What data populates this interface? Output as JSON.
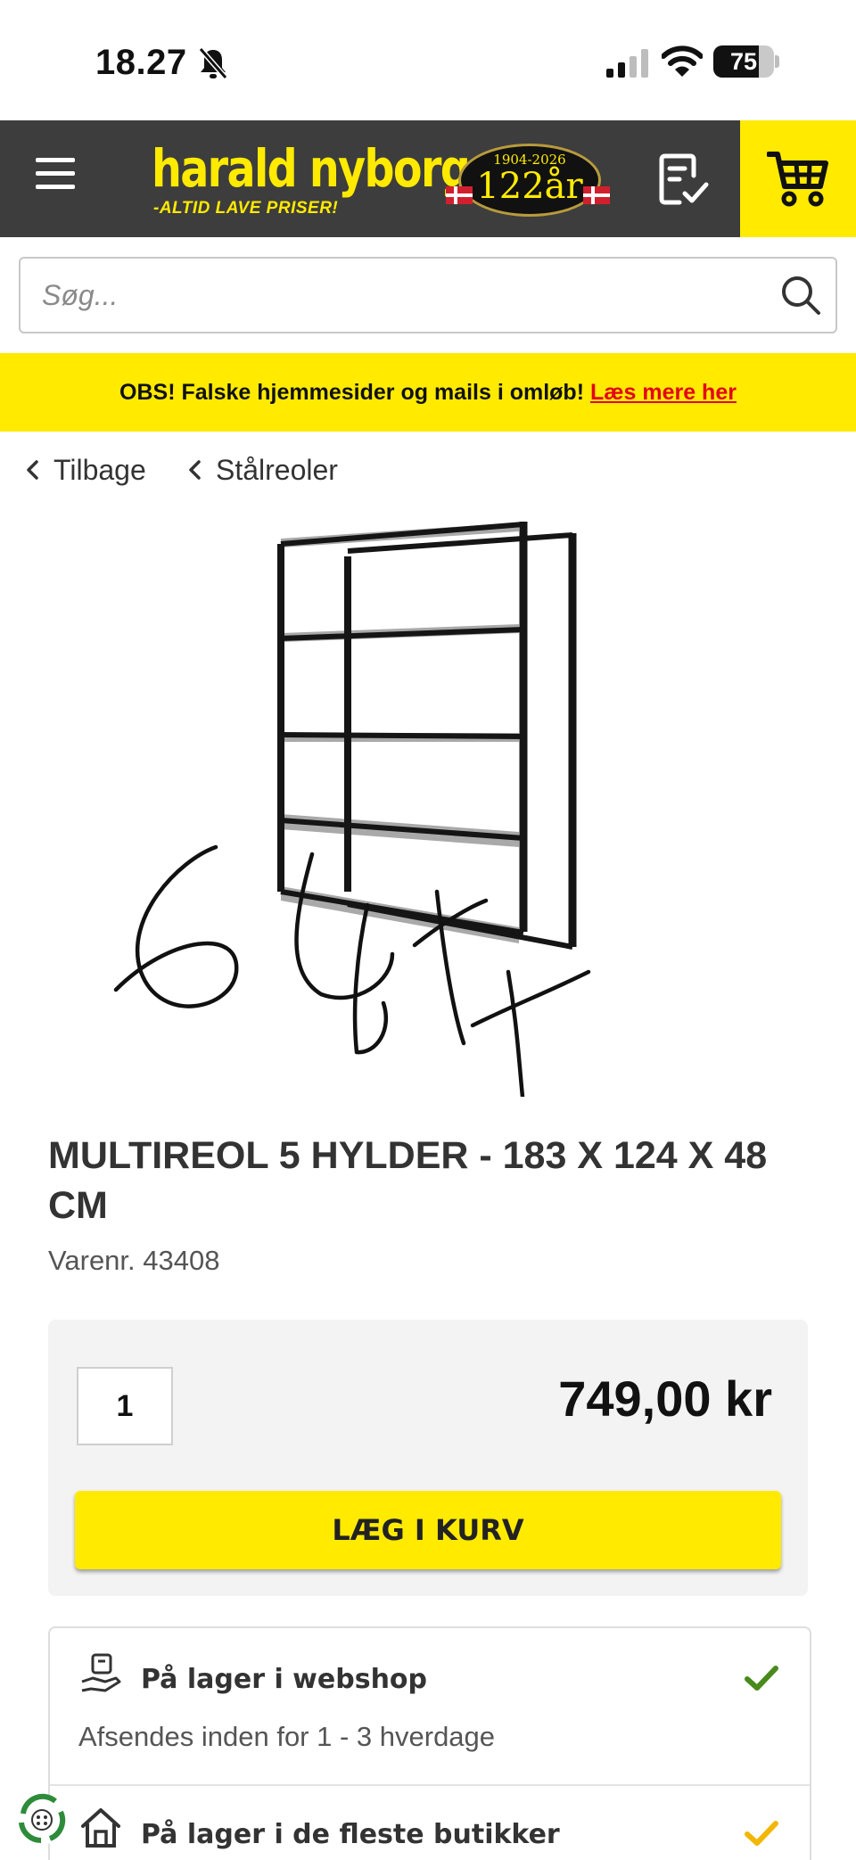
{
  "status_bar": {
    "time": "18.27",
    "battery": "75",
    "battery_level": 0.75
  },
  "header": {
    "brand": "harald nyborg",
    "tagline": "-ALTID LAVE PRISER!",
    "anniversary_years": "1904-2026",
    "anniversary_number": "122år"
  },
  "search": {
    "placeholder": "Søg..."
  },
  "banner": {
    "text": "OBS! Falske hjemmesider og mails i omløb!",
    "link": "Læs mere her"
  },
  "breadcrumbs": {
    "back": "Tilbage",
    "category": "Stålreoler"
  },
  "product": {
    "title": "MULTIREOL 5 HYLDER - 183 X 124 X 48 CM",
    "sku": "Varenr. 43408",
    "quantity": "1",
    "price": "749,00 kr",
    "add_to_cart": "LÆG I KURV"
  },
  "stock": {
    "webshop_title": "På lager i webshop",
    "webshop_sub": "Afsendes inden for 1 - 3 hverdage",
    "stores_title": "På lager i de fleste butikker"
  },
  "colors": {
    "brand_yellow": "#ffea00",
    "header_dark": "#3d3d3d",
    "link_red": "#e3001b",
    "check_green": "#4a8a1c",
    "check_yellow": "#f2b705"
  }
}
